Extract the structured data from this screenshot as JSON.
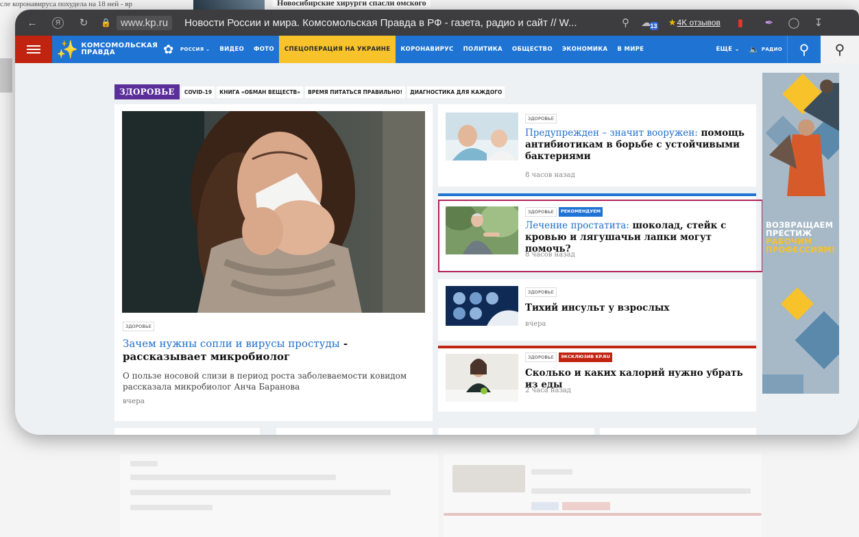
{
  "background": {
    "left_text": "сле коронавируса похудела на 18 ней - вр",
    "top_headline": "Новосибирские хирурги спасли омского"
  },
  "browser": {
    "domain": "www.kp.ru",
    "tab_title": "Новости России и мира. Комсомольская Правда в РФ - газета, радио и сайт // W...",
    "reviews_label": "4K отзывов",
    "extension_badge": "13"
  },
  "nav": {
    "logo_line1": "КОМСОМОЛЬСКАЯ",
    "logo_line2": "ПРАВДА",
    "items": [
      "РОССИЯ",
      "ВИДЕО",
      "ФОТО",
      "СПЕЦОПЕРАЦИЯ НА УКРАИНЕ",
      "КОРОНАВИРУС",
      "ПОЛИТИКА",
      "ОБЩЕСТВО",
      "ЭКОНОМИКА",
      "В МИРЕ"
    ],
    "more_label": "ЕЩЕ",
    "radio_label": "РАДИО",
    "accent_color": "#1e73d3",
    "highlight_color": "#f7c22a"
  },
  "section": {
    "title": "ЗДОРОВЬЕ",
    "tags": [
      "COVID-19",
      "КНИГА «ОБМАН ВЕЩЕСТВ»",
      "ВРЕМЯ ПИТАТЬСЯ ПРАВИЛЬНО!",
      "ДИАГНОСТИКА ДЛЯ КАЖДОГО"
    ]
  },
  "main_article": {
    "tag": "ЗДОРОВЬЕ",
    "title_link": "Зачем нужны сопли и вирусы простуды",
    "title_rest": " - рассказывает микробиолог",
    "lead": "О пользе носовой слизи в период роста заболеваемости ковидом рассказала микробиолог Анча Баранова",
    "time": "вчера"
  },
  "side_articles": [
    {
      "tag": "ЗДОРОВЬЕ",
      "title_link": "Предупрежден – значит вооружен:",
      "title_rest": " помощь антибиотикам в борьбе с устойчивыми бактериями",
      "time": "8 часов назад"
    },
    {
      "tag": "ЗДОРОВЬЕ",
      "badge": "РЕКОМЕНДУЕМ",
      "title_link": "Лечение простатита:",
      "title_rest": " шоколад, стейк с кровью и лягушачьи лапки могут помочь?",
      "time": "8 часов назад"
    },
    {
      "tag": "ЗДОРОВЬЕ",
      "title_link": "",
      "title_rest": "Тихий инсульт у взрослых",
      "time": "вчера"
    },
    {
      "tag": "ЗДОРОВЬЕ",
      "badge": "ЭКСКЛЮЗИВ KP.RU",
      "title_link": "",
      "title_rest": "Сколько и каких калорий нужно убрать из еды",
      "time": "2 часа назад"
    }
  ],
  "ad": {
    "line1": "ВОЗВРАЩАЕМ",
    "line2": "ПРЕСТИЖ",
    "line3": "РАБОЧИМ",
    "line4": "ПРОФЕССИЯМ!"
  }
}
